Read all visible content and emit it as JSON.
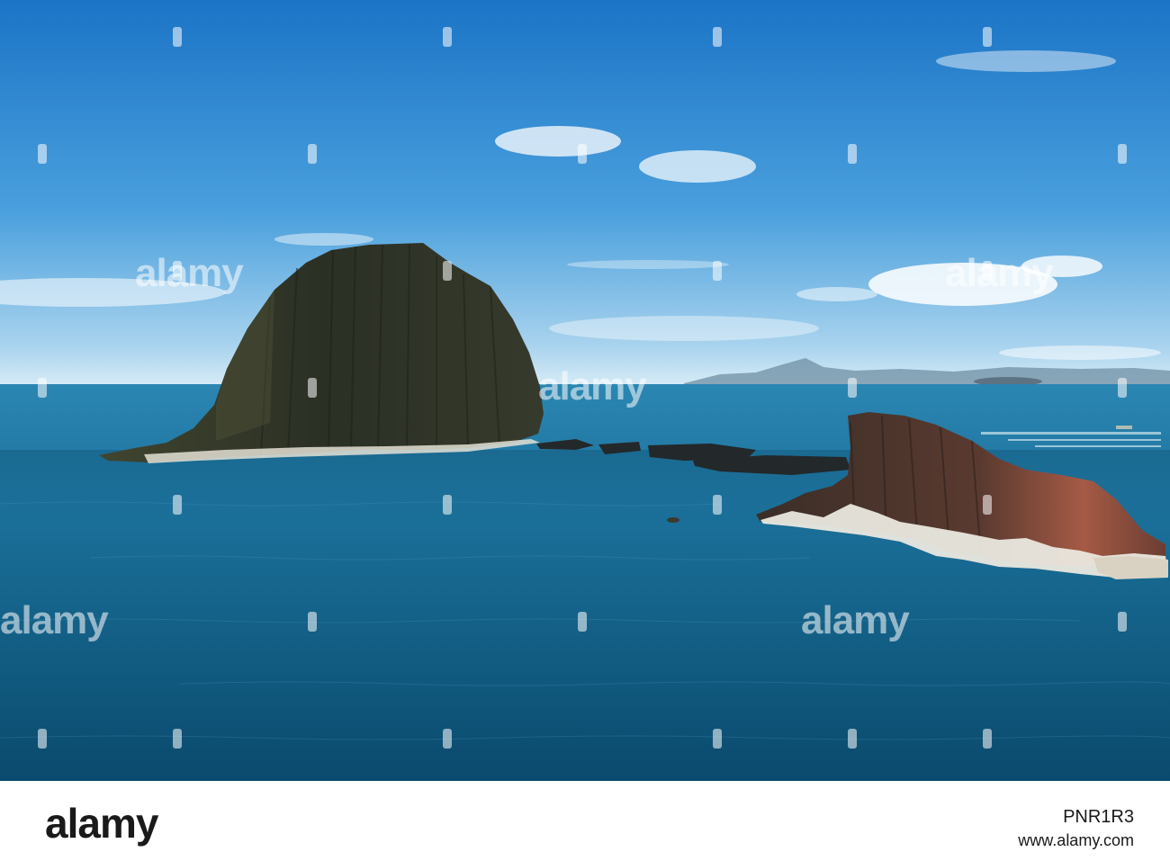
{
  "watermark": {
    "text": "alamy"
  },
  "footer": {
    "logo": "alamy",
    "image_id": "PNR1R3",
    "site": "www.alamy.com"
  },
  "colors": {
    "sky_top": "#1f7fcf",
    "sky_horizon": "#cfe6f5",
    "sea_top": "#2a7fa8",
    "sea_bottom": "#0b4d70",
    "rock_dark": "#2c2f27",
    "rock_red": "#8a4a3a",
    "rock_white": "#e8e6df"
  }
}
